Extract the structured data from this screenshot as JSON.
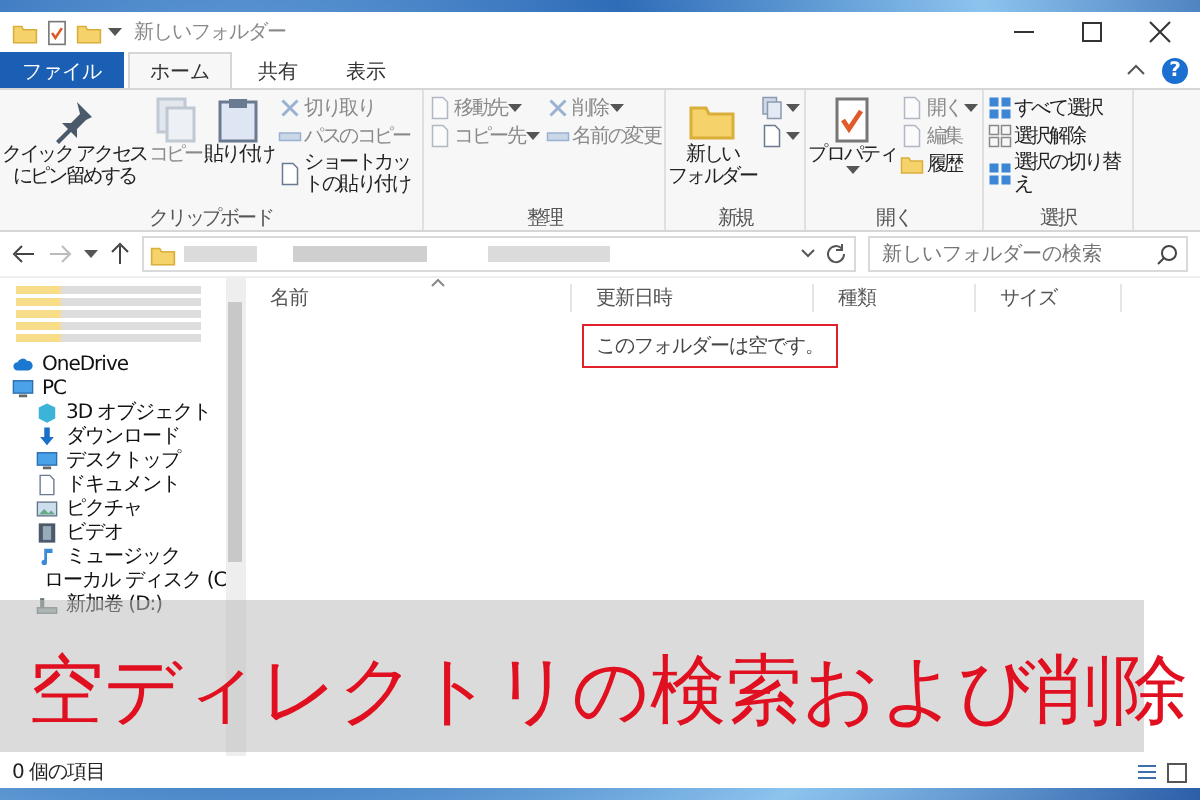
{
  "window": {
    "title": "新しいフォルダー",
    "help": "?"
  },
  "tabs": [
    {
      "label": "ファイル",
      "kind": "file",
      "selected": false
    },
    {
      "label": "ホーム",
      "kind": "tab",
      "selected": true
    },
    {
      "label": "共有",
      "kind": "tab",
      "selected": false
    },
    {
      "label": "表示",
      "kind": "tab",
      "selected": false
    }
  ],
  "ribbon": [
    {
      "label": "クリップボード",
      "items": [
        {
          "lines": [
            "クイック アクセス",
            "にピン留めする"
          ],
          "kind": "large",
          "disabled": false
        },
        {
          "lines": [
            "コピー"
          ],
          "kind": "large",
          "disabled": true
        },
        {
          "lines": [
            "貼り付け"
          ],
          "kind": "large",
          "disabled": false
        },
        {
          "kind": "column",
          "items": [
            {
              "label": "切り取り",
              "disabled": true
            },
            {
              "label": "パスのコピー",
              "disabled": true
            },
            {
              "label": "ショートカットの貼り付け",
              "disabled": false
            }
          ]
        }
      ]
    },
    {
      "label": "整理",
      "items": [
        {
          "kind": "column",
          "items": [
            {
              "label": "移動先",
              "disabled": true,
              "dropdown": true
            },
            {
              "label": "コピー先",
              "disabled": true,
              "dropdown": true
            }
          ]
        },
        {
          "kind": "column",
          "items": [
            {
              "label": "削除",
              "disabled": true,
              "dropdown": true
            },
            {
              "label": "名前の変更",
              "disabled": true
            }
          ]
        }
      ]
    },
    {
      "label": "新規",
      "items": [
        {
          "lines": [
            "新しい",
            "フォルダー"
          ],
          "kind": "large",
          "disabled": false
        },
        {
          "kind": "column",
          "items": [
            {
              "disabled": false,
              "dropdown": true
            },
            {
              "disabled": false,
              "dropdown": true
            }
          ]
        }
      ]
    },
    {
      "label": "開く",
      "items": [
        {
          "lines": [
            "プロパティ"
          ],
          "kind": "large",
          "disabled": false,
          "dropdown": true
        },
        {
          "kind": "column",
          "items": [
            {
              "label": "開く",
              "disabled": true,
              "dropdown": true
            },
            {
              "label": "編集",
              "disabled": true
            },
            {
              "label": "履歴",
              "disabled": false
            }
          ]
        }
      ]
    },
    {
      "label": "選択",
      "items": [
        {
          "kind": "column",
          "items": [
            {
              "label": "すべて選択",
              "disabled": false
            },
            {
              "label": "選択解除",
              "disabled": false
            },
            {
              "label": "選択の切り替え",
              "disabled": false
            }
          ]
        }
      ]
    }
  ],
  "search": {
    "placeholder": "新しいフォルダーの検索"
  },
  "columns": [
    {
      "label": "名前"
    },
    {
      "label": "更新日時"
    },
    {
      "label": "種類"
    },
    {
      "label": "サイズ"
    }
  ],
  "empty_message": "このフォルダーは空です。",
  "navigation": [
    {
      "label": "OneDrive"
    },
    {
      "label": "PC",
      "children": [
        {
          "label": "3D オブジェクト"
        },
        {
          "label": "ダウンロード"
        },
        {
          "label": "デスクトップ"
        },
        {
          "label": "ドキュメント"
        },
        {
          "label": "ピクチャ"
        },
        {
          "label": "ビデオ"
        },
        {
          "label": "ミュージック"
        },
        {
          "label": "ローカル ディスク (C"
        },
        {
          "label": "新加卷 (D:)"
        }
      ]
    }
  ],
  "status_bar": {
    "text": "0 個の項目"
  },
  "banner": {
    "text": "空ディレクトリの検索および削除"
  }
}
